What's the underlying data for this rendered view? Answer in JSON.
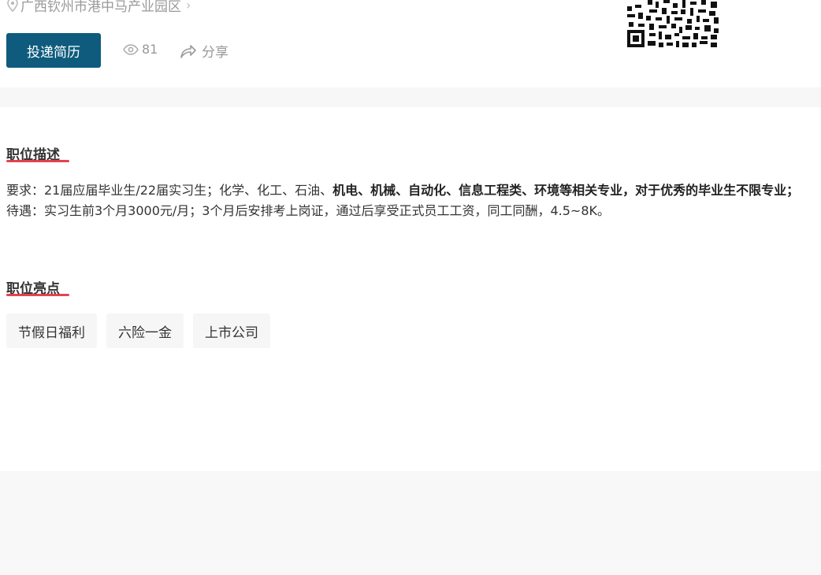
{
  "location": {
    "text": "广西钦州市港中马产业园区",
    "chevron": "›",
    "icon": "map-pin-icon"
  },
  "actions": {
    "apply_label": "投递简历",
    "views_count": "81",
    "views_icon": "eye-icon",
    "share_label": "分享",
    "share_icon": "share-arrow-icon"
  },
  "qr": {
    "icon": "qr-code-icon"
  },
  "description": {
    "title": "职位描述",
    "req_prefix": "要求：21届应届毕业生/22届实习生；化学、化工、石油、",
    "req_bold": "机电、机械、自动化、信息工程类、环境等相关专业，对于优秀的毕业生不限专业；",
    "benefits": "待遇：实习生前3个月3000元/月；3个月后安排考上岗证，通过后享受正式员工工资，同工同酬，4.5~8K。"
  },
  "highlights": {
    "title": "职位亮点",
    "tags": [
      "节假日福利",
      "六险一金",
      "上市公司"
    ]
  },
  "colors": {
    "primary_button": "#0e5b7d",
    "title_underline": "#e0303b"
  }
}
